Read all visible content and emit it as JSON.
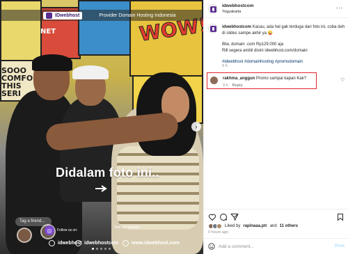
{
  "photo": {
    "banner_brand": "IDwebhost",
    "banner_provider": "Provider Domain Hosting Indonesia",
    "comic_text_1": "SOOO COMFORT THIS SERI",
    "comic_text_2": "WOW!",
    "comic_text_3": "NET",
    "overlay_text": "Didalam foto ini..",
    "tag_friend": "Tag a friend...",
    "follow_label": "Follow us on:",
    "visit_label": "Visit our website:",
    "footer_handle_1": "idwebhost",
    "footer_handle_2": "idwebhostcom",
    "footer_website": "www.idwebhost.com"
  },
  "post": {
    "username": "idwebhostcom",
    "location": "Yogyakarta",
    "caption": {
      "username": "idwebhostcom",
      "line1": "Kacau, ada hal gak terduga dari foto ini, coba deh di slides sampe akhir ya 😜",
      "line2": "Btw, domain .com Rp129.000 aja",
      "line3": "Rill segera ambil disini idwebhost.com/domain",
      "hashtags": "#idwebhost #domainhosting #promodomain",
      "time": "9 h"
    },
    "comment": {
      "username": "rakhma_anggun",
      "text": "Promo sampai kapan Kak?",
      "time": "9 h",
      "reply_label": "Reply"
    },
    "likes": {
      "prefix": "Liked by",
      "user": "rapinaaa.ptr",
      "connector": "and",
      "others": "11 others"
    },
    "posted": "9 hours ago",
    "add_comment_placeholder": "Add a comment...",
    "post_button": "Post"
  },
  "colors": {
    "brand_purple": "#5a2d91",
    "highlight_red": "#e0242a",
    "link_blue": "#00376b",
    "post_button_disabled": "#b2dffc"
  }
}
